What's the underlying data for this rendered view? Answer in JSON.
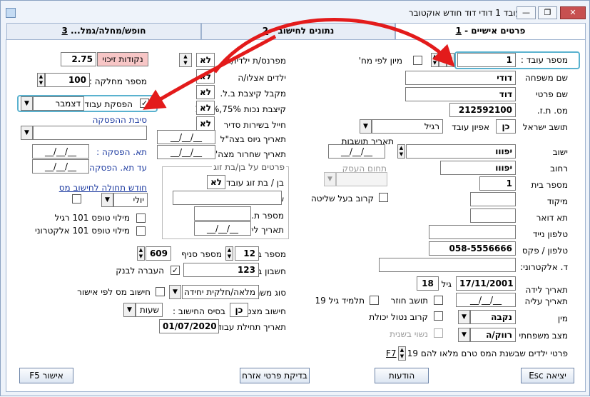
{
  "window": {
    "title": "עובד 1 דודי דוד    חודש אוקטובר",
    "minimize": "—",
    "maximize": "❐",
    "close": "✕"
  },
  "tabs": [
    {
      "label": "פרטים אישיים - ",
      "num": "1"
    },
    {
      "label": "נתונים לחישוב - ",
      "num": "2"
    },
    {
      "label": "חופש/מחלה/גמל... ",
      "num": "3"
    }
  ],
  "right": {
    "employee_no_label": "מספר עובד :",
    "employee_no": "1",
    "sort_by_dept_label": "מיון לפי מח'",
    "last_name_label": "שם משפחה",
    "last_name": "דודי",
    "first_name_label": "שם פרטי",
    "first_name": "דוד",
    "id_label": "מס. ת.ז.",
    "id": "212592100",
    "resident_label": "תושב ישראל",
    "resident": "כן",
    "emp_type_label": "אפיון עובד",
    "emp_type": "רגיל",
    "settlement_date_label": "תאריך תושבות",
    "settlement_date": "__/__/__",
    "city_label": "ישוב",
    "city": "יפווו",
    "street_label": "רחוב",
    "street": "יפווו",
    "house_label": "מספר בית",
    "house": "1",
    "business_field_label": "תחום העסק",
    "controlling_label": "קרוב בעל שליטה",
    "zip_label": "מיקוד",
    "pobox_label": "תא דואר",
    "mobile_label": "טלפון נייד",
    "phone_label": "טלפון / פקס",
    "phone": "058-5556666",
    "email_label": "ד. אלקטרוני:",
    "birth_label": "תאריך לידה",
    "birth": "17/11/2001",
    "age_label": "גיל",
    "age": "18",
    "aliyah_label": "תאריך עליה",
    "aliyah": "__/__/__",
    "returning_label": "תושב חוזר",
    "student_label": "תלמיד גיל 19",
    "gender_label": "מין",
    "gender": "נקבה",
    "disabled_label": "קרוב נטול יכולת",
    "marital_label": "מצב משפחתי",
    "marital": "רווק/ה",
    "second_marriage_label": "נשוי בשנית",
    "children_note": "פרטי ילדים שבשנת המס טרם מלאו להם 19",
    "f7": "F7"
  },
  "middle": {
    "parent_label": "מפרנס/ת ילדיו/ה",
    "parent": "לא",
    "kids_with_label": "ילדים אצלו/ה",
    "kids_with": "לא",
    "allowance_label": "מקבל קיצבת ב.ל.",
    "allowance": "לא",
    "disability_label": "קיצבת נכות 75%,100%",
    "disability": "לא",
    "service_label": "חייל בשירות סדיר",
    "service": "לא",
    "army_in_label": "תאריך גיוס בצה\"ל",
    "army_in": "__/__/__",
    "army_out_label": "תאריך שחרור מצה\"ל",
    "army_out": "__/__/__",
    "spouse_group": "פרטים על בן/בת זוג",
    "spouse_works_label": "בן / בת זוג עובד ?",
    "spouse_works": "לא",
    "spouse_name_label": "שם",
    "spouse_id_label": "מספר ת.ז.",
    "spouse_birth_label": "תאריך לידה",
    "spouse_birth": "__/__/__"
  },
  "left": {
    "credit_points_label": "נקודות זיכוי",
    "credit_points": "2.75",
    "department_label": "מספר מחלקה :",
    "department": "100",
    "stop_label": "הפסקת עבודה מ :",
    "stop_month": "דצמבר",
    "stop_reason_label": "סיבת ההפסקה",
    "stop_date_label": "תא. הפסקה :",
    "stop_date": "__/__/__",
    "until_label": "עד תא. הפסקה :",
    "until_date": "__/__/__",
    "tax_month_label": "חודש תחולה לחישוב מס",
    "tax_month": "יולי",
    "form101_regular": "מילוי טופס 101 רגיל",
    "form101_electronic": "מילוי טופס 101 אלקטרוני"
  },
  "bottom": {
    "bank_label": "מספר בנק",
    "bank": "12",
    "branch_label": "מספר סניף",
    "branch": "609",
    "account_label": "חשבון בנק",
    "account": "123",
    "transfer_label": "העברה לבנק",
    "job_type_label": "סוג משרה",
    "job_type": "מלאה/חלקית יחידה",
    "tax_approval_label": "חישוב מס לפי אישור",
    "cumulative_label": "חישוב מצטבר",
    "cumulative": "כן",
    "basis_label": "בסיס החישוב :",
    "basis": "שעות",
    "start_label": "תאריך תחילת עבודה",
    "start": "01/07/2020"
  },
  "buttons": {
    "escape": "יציאה Esc",
    "messages": "הודעות",
    "check_citizen": "בדיקת פרטי אזרח",
    "approve": "אישור F5"
  }
}
